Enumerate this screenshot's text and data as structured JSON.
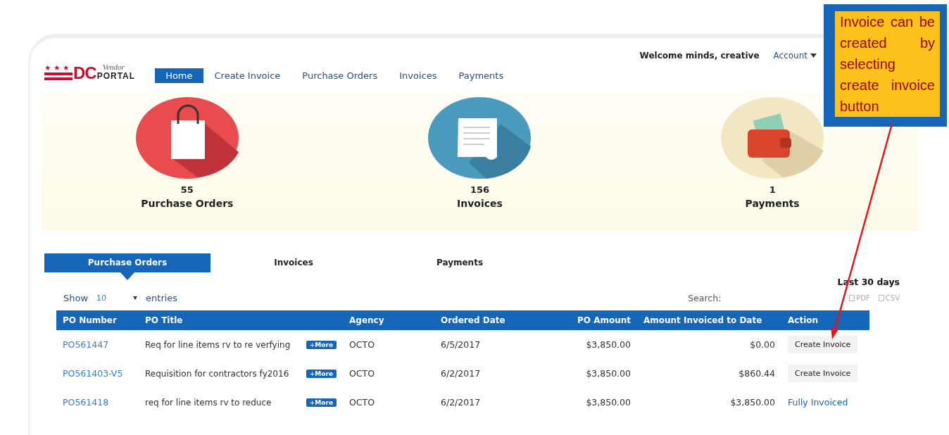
{
  "header": {
    "logo": {
      "script": "Vendor",
      "mark": "DC",
      "word": "PORTAL"
    },
    "nav": [
      {
        "label": "Home",
        "selected": true
      },
      {
        "label": "Create Invoice",
        "selected": false
      },
      {
        "label": "Purchase Orders",
        "selected": false
      },
      {
        "label": "Invoices",
        "selected": false
      },
      {
        "label": "Payments",
        "selected": false
      }
    ],
    "welcome": "Welcome minds, creative",
    "account": "Account"
  },
  "stats": [
    {
      "kind": "bag",
      "count": "55",
      "label": "Purchase Orders"
    },
    {
      "kind": "receipt",
      "count": "156",
      "label": "Invoices"
    },
    {
      "kind": "wallet",
      "count": "1",
      "label": "Payments"
    }
  ],
  "tabs": [
    {
      "label": "Purchase Orders",
      "selected": true
    },
    {
      "label": "Invoices",
      "selected": false
    },
    {
      "label": "Payments",
      "selected": false
    }
  ],
  "period": "Last 30 days",
  "length_menu": {
    "before": "Show",
    "value": "10",
    "after": "entries"
  },
  "search": {
    "label": "Search:"
  },
  "exports": [
    "PDF",
    "CSV"
  ],
  "table": {
    "columns": [
      "PO Number",
      "PO Title",
      "Agency",
      "Ordered Date",
      "PO Amount",
      "Amount Invoiced to Date",
      "Action"
    ],
    "rows": [
      {
        "po": "PO561447",
        "title": "Req for line items rv to re verfying",
        "more": "+More",
        "agency": "OCTO",
        "date": "6/5/2017",
        "amount": "$3,850.00",
        "invoiced": "$0.00",
        "action": {
          "kind": "button",
          "text": "Create Invoice"
        }
      },
      {
        "po": "PO561403-V5",
        "title": "Requisition for contractors fy2016",
        "more": "+More",
        "agency": "OCTO",
        "date": "6/2/2017",
        "amount": "$3,850.00",
        "invoiced": "$860.44",
        "action": {
          "kind": "button",
          "text": "Create Invoice"
        }
      },
      {
        "po": "PO561418",
        "title": "req for line items rv to reduce",
        "more": "+More",
        "agency": "OCTO",
        "date": "6/2/2017",
        "amount": "$3,850.00",
        "invoiced": "$3,850.00",
        "action": {
          "kind": "link",
          "text": "Fully Invoiced"
        }
      }
    ]
  },
  "callout": "Invoice can be created by selecting create invoice button"
}
